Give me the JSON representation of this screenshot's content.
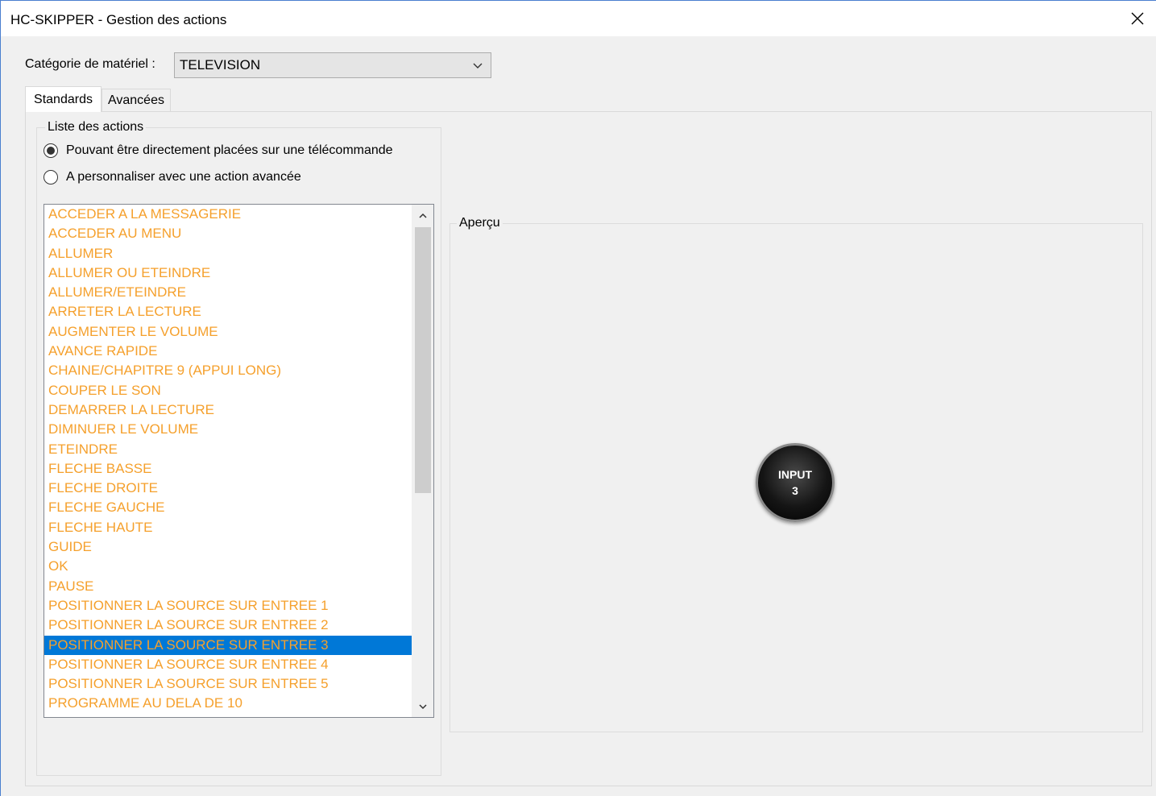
{
  "window": {
    "title": "HC-SKIPPER - Gestion des actions"
  },
  "category": {
    "label": "Catégorie de matériel  :",
    "selected": "TELEVISION"
  },
  "tabs": [
    {
      "label": "Standards",
      "active": true
    },
    {
      "label": "Avancées",
      "active": false
    }
  ],
  "actions_group": {
    "legend": "Liste des actions",
    "radio_options": [
      {
        "label": "Pouvant être directement placées sur une télécommande",
        "checked": true
      },
      {
        "label": "A personnaliser avec une action avancée",
        "checked": false
      }
    ],
    "items": [
      "ACCEDER A LA MESSAGERIE",
      "ACCEDER AU MENU",
      "ALLUMER",
      "ALLUMER OU ETEINDRE",
      "ALLUMER/ETEINDRE",
      "ARRETER LA LECTURE",
      "AUGMENTER LE VOLUME",
      "AVANCE RAPIDE",
      "CHAINE/CHAPITRE 9 (APPUI LONG)",
      "COUPER LE SON",
      "DEMARRER LA LECTURE",
      "DIMINUER LE VOLUME",
      "ETEINDRE",
      "FLECHE BASSE",
      "FLECHE DROITE",
      "FLECHE GAUCHE",
      "FLECHE HAUTE",
      "GUIDE",
      "OK",
      "PAUSE",
      "POSITIONNER LA SOURCE SUR ENTREE 1",
      "POSITIONNER LA SOURCE SUR ENTREE 2",
      "POSITIONNER LA SOURCE SUR ENTREE 3",
      "POSITIONNER LA SOURCE SUR ENTREE 4",
      "POSITIONNER LA SOURCE SUR ENTREE 5",
      "PROGRAMME AU DELA DE 10"
    ],
    "selected_index": 22,
    "item_color": "#f5a02c",
    "selected_bg": "#0078d7"
  },
  "preview": {
    "legend": "Aperçu",
    "button_line1": "INPUT",
    "button_line2": "3"
  },
  "icons": {
    "close": "close-icon",
    "dropdown": "chevron-down-icon",
    "scroll_up": "chevron-up-icon",
    "scroll_down": "chevron-down-icon"
  }
}
